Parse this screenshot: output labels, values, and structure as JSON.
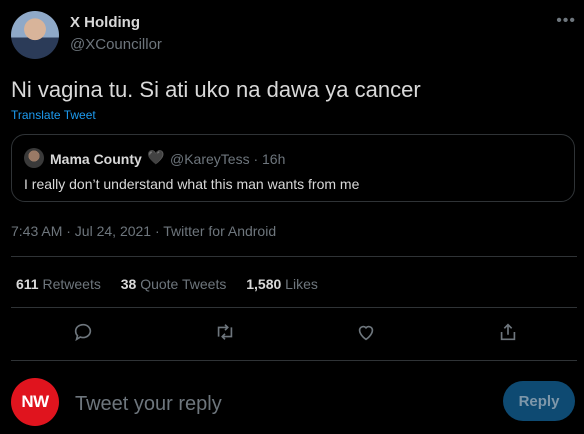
{
  "author": {
    "name": "X Holding",
    "handle": "@XCouncillor"
  },
  "more_icon": "•••",
  "tweet": {
    "text": "Ni vagina tu. Si ati uko na dawa ya cancer",
    "translate_label": "Translate Tweet"
  },
  "quote": {
    "name": "Mama County",
    "heart": "🖤",
    "meta": "@KareyTess · 16h",
    "text": "I really don’t understand what this man wants from me"
  },
  "timestamp": "7:43 AM · Jul 24, 2021 · Twitter for Android",
  "stats": {
    "retweets_count": "611",
    "retweets_label": "Retweets",
    "quotes_count": "38",
    "quotes_label": "Quote Tweets",
    "likes_count": "1,580",
    "likes_label": "Likes"
  },
  "reply_bar": {
    "avatar_text": "NW",
    "placeholder": "Tweet your reply",
    "button_label": "Reply"
  },
  "colors": {
    "accent": "#1d9bf0",
    "background": "#000000",
    "nw_red": "#e0141e"
  }
}
